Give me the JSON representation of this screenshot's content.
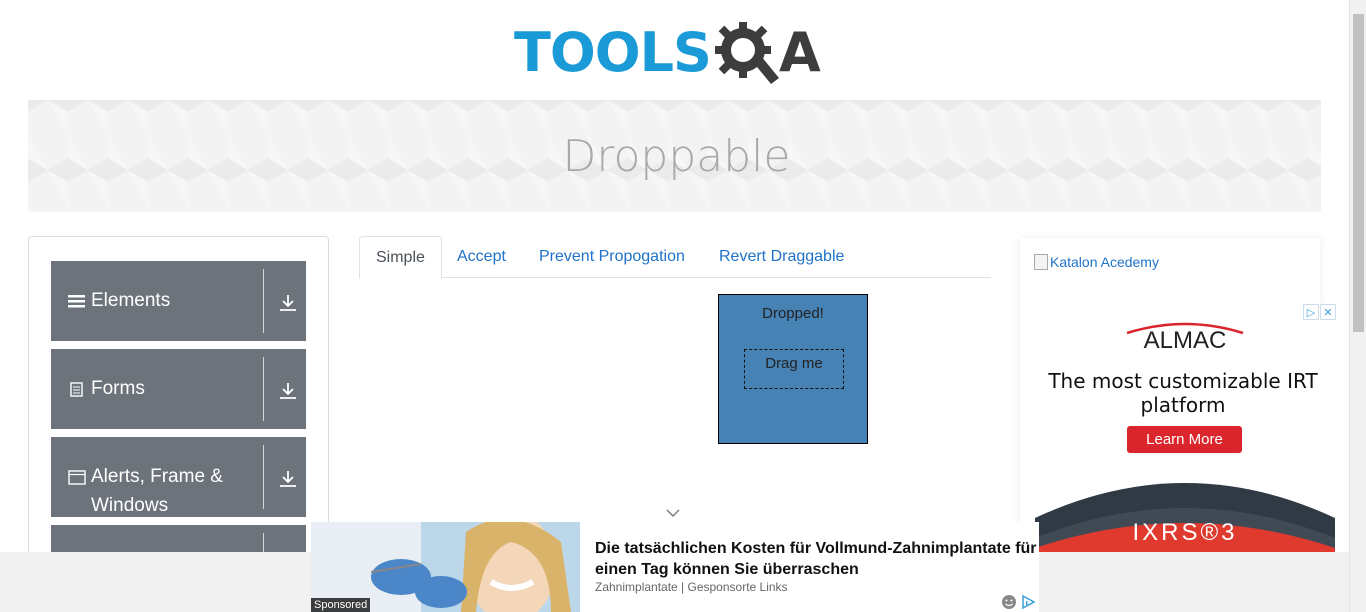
{
  "header": {
    "logo_tools": "TOOLS",
    "logo_a": "A",
    "logo_colors": {
      "tools": "#1a9ad6",
      "qa": "#3d3d3d"
    }
  },
  "banner": {
    "title": "Droppable"
  },
  "sidebar": {
    "groups": [
      {
        "label": "Elements",
        "icon": "list-icon"
      },
      {
        "label": "Forms",
        "icon": "document-icon"
      },
      {
        "label": "Alerts, Frame & Windows",
        "icon": "window-icon"
      }
    ]
  },
  "tabs": [
    {
      "label": "Simple",
      "active": true
    },
    {
      "label": "Accept",
      "active": false
    },
    {
      "label": "Prevent Propogation",
      "active": false
    },
    {
      "label": "Revert Draggable",
      "active": false
    }
  ],
  "simple": {
    "drop_text": "Dropped!",
    "drag_text": "Drag me",
    "drop_color": "#4682b4"
  },
  "right_ad": {
    "katalon_alt": "Katalon Acedemy",
    "brand": "ALMAC",
    "headline": "The most customizable IRT platform",
    "cta": "Learn More",
    "product": "IXRS®3",
    "accent": "#d9252b"
  },
  "bottom_ad": {
    "sponsored": "Sponsored",
    "headline": "Die tatsächlichen Kosten für Vollmund-Zahnimplantate für einen Tag können Sie überraschen",
    "source": "Zahnimplantate | Gesponsorte Links"
  }
}
